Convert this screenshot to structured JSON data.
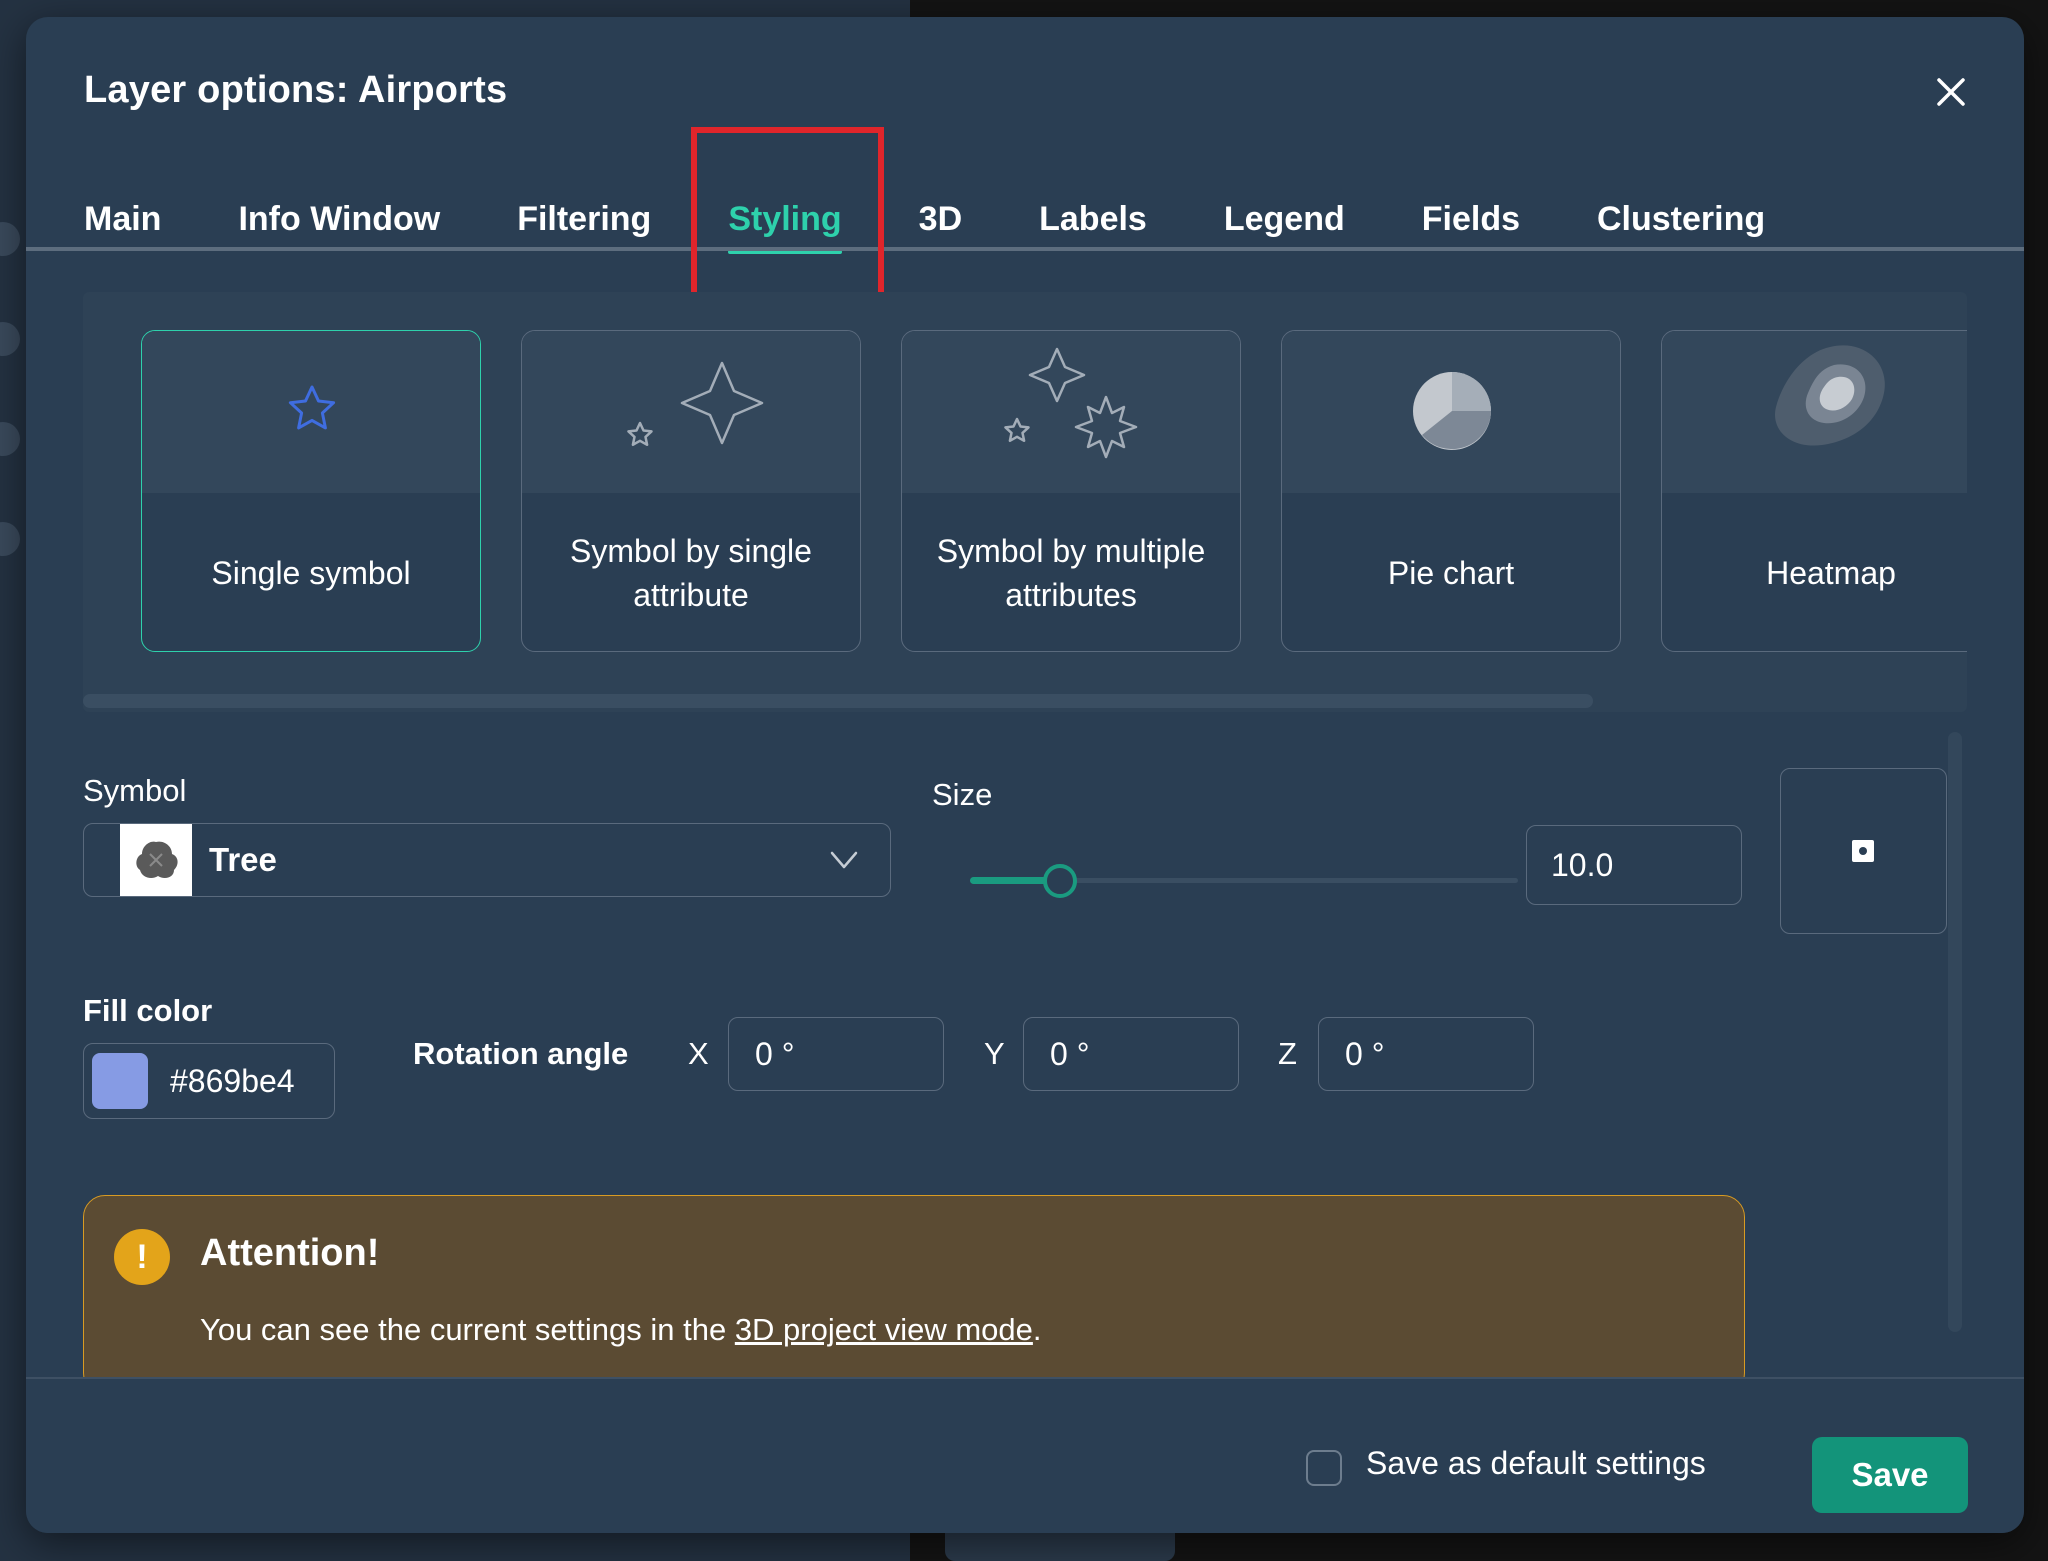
{
  "dialog": {
    "title": "Layer options: Airports",
    "close_icon": "close-icon"
  },
  "tabs": [
    {
      "label": "Main",
      "active": false
    },
    {
      "label": "Info Window",
      "active": false
    },
    {
      "label": "Filtering",
      "active": false
    },
    {
      "label": "Styling",
      "active": true
    },
    {
      "label": "3D",
      "active": false
    },
    {
      "label": "Labels",
      "active": false
    },
    {
      "label": "Legend",
      "active": false
    },
    {
      "label": "Fields",
      "active": false
    },
    {
      "label": "Clustering",
      "active": false
    }
  ],
  "style_types": [
    {
      "label": "Single symbol",
      "icon": "star-icon",
      "selected": true
    },
    {
      "label": "Symbol by single attribute",
      "icon": "stars-icon",
      "selected": false
    },
    {
      "label": "Symbol by multiple attributes",
      "icon": "multi-stars-icon",
      "selected": false
    },
    {
      "label": "Pie chart",
      "icon": "pie-chart-icon",
      "selected": false
    },
    {
      "label": "Heatmap",
      "icon": "heatmap-icon",
      "selected": false
    }
  ],
  "symbol": {
    "label": "Symbol",
    "value": "Tree",
    "icon": "tree-icon"
  },
  "size": {
    "label": "Size",
    "value": "10.0",
    "slider_fraction": 0.165
  },
  "fill_color": {
    "label": "Fill color",
    "value": "#869be4"
  },
  "rotation": {
    "label": "Rotation angle",
    "x_label": "X",
    "x_value": "0 °",
    "y_label": "Y",
    "y_value": "0 °",
    "z_label": "Z",
    "z_value": "0 °"
  },
  "alert": {
    "title": "Attention!",
    "text_prefix": "You can see the current settings in the ",
    "link": "3D project view mode",
    "text_suffix": "."
  },
  "footer": {
    "checkbox_label": "Save as default settings",
    "save_label": "Save"
  },
  "colors": {
    "accent": "#2ed1ac",
    "save_button": "#13947a",
    "alert_border": "#d89b23",
    "highlight": "#e0252b"
  }
}
